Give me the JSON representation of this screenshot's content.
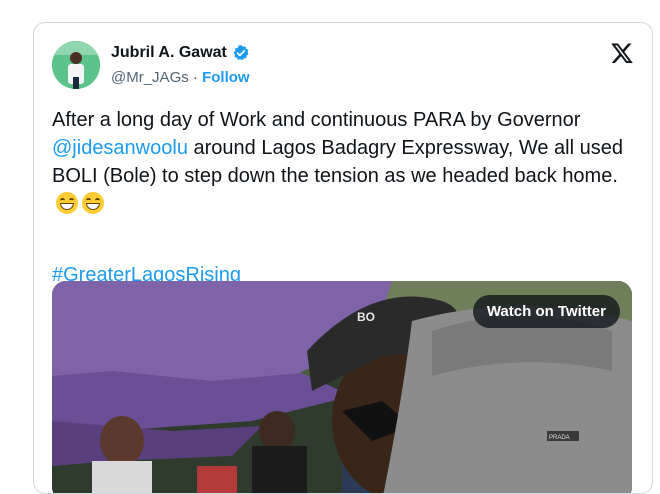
{
  "author": {
    "name": "Jubril A. Gawat",
    "handle": "@Mr_JAGs",
    "separator": "·",
    "follow_label": "Follow"
  },
  "tweet": {
    "text_part1": "After a long day of Work and continuous PARA by Governor ",
    "mention": "@jidesanwoolu",
    "text_part2": " around Lagos Badagry Expressway, We all used BOLI (Bole) to step down the tension as we headed back home.",
    "emoji_icons": [
      "grinning-face-icon",
      "grinning-face-icon"
    ],
    "hashtag": "#GreaterLagosRising"
  },
  "media": {
    "watch_label": "Watch on Twitter",
    "cap_text": "BO",
    "shirt_text": "PRADA"
  },
  "colors": {
    "link": "#1d9bf0",
    "text": "#0f1419",
    "muted": "#536471",
    "border": "#cfd9de"
  }
}
